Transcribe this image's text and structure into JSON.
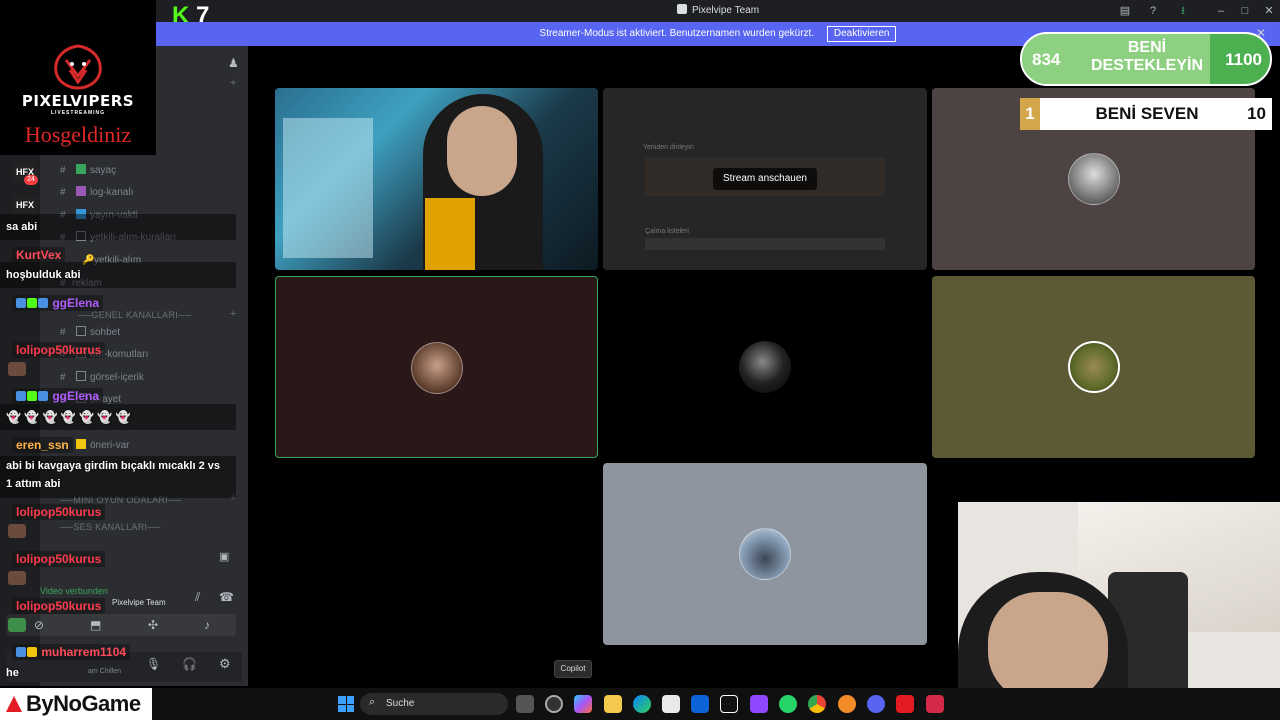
{
  "window": {
    "title": "Pixelvipe Team"
  },
  "banner": {
    "text": "Streamer-Modus ist aktiviert. Benutzernamen wurden gekürzt.",
    "button_label": "Deaktivieren"
  },
  "logo": {
    "brand": "PIXELVIPERS",
    "sub": "LIVESTREAMING",
    "welcome": "Hosgeldiniz"
  },
  "kick_counter": {
    "value": "7"
  },
  "sidebar": {
    "categories": [
      "GENEL KANALLARI",
      "MİNİ OYUN ODALARI",
      "SES KANALLARI"
    ],
    "channels": [
      "sayaç",
      "log-kanalı",
      "yayın-vakti",
      "yetkili-alım-kuralları",
      "yetkili-alım",
      "reklam",
      "sohbet",
      "bot-komutları",
      "görsel-içerik",
      "şikayet",
      "öneri-var"
    ],
    "voice_status": "Video verbunden",
    "voice_channel": "Pixelvipe Team",
    "user_status": "am Chillen"
  },
  "chat": [
    {
      "user": "",
      "message": "sa abi"
    },
    {
      "user": "KurtVex",
      "message": "hoşbulduk abi"
    },
    {
      "user": "ggElena",
      "message": ""
    },
    {
      "user": "lolipop50kurus",
      "message": ""
    },
    {
      "user": "ggElena",
      "message": "👻 👻 👻 👻 👻 👻 👻"
    },
    {
      "user": "eren_ssn",
      "message": "abi bi kavgaya girdim bıçaklı mıcaklı 2 vs 1 attım abi"
    },
    {
      "user": "lolipop50kurus",
      "message": ""
    },
    {
      "user": "lolipop50kurus",
      "message": ""
    },
    {
      "user": "lolipop50kurus",
      "message": ""
    },
    {
      "user": "muharrem1104",
      "message": "he"
    }
  ],
  "chat_colors": {
    "KurtVex": "#ff4b5c",
    "ggElena": "#b15cff",
    "lolipop50kurus": "#ff3b4e",
    "eren_ssn": "#ffb347",
    "muharrem1104": "#ff4b5c"
  },
  "video": {
    "stream_label": "Stream anschauen",
    "screen_overlay_heading": "Yeniden dinleyin",
    "screen_overlay_section": "Çalma listeleri"
  },
  "goal": {
    "current": "834",
    "label": "BENİ DESTEKLEYİN",
    "max": "1100",
    "progress": 0.758
  },
  "lover_widget": {
    "rank": "1",
    "label": "BENİ SEVEN",
    "value": "10"
  },
  "taskbar": {
    "search_label": "Suche",
    "tooltip": "Copilot",
    "sponsor": "ByNoGame"
  },
  "colors": {
    "accent": "#5865f2",
    "kick_green": "#53fc18",
    "goal_green": "#4caf50",
    "gold": "#d4a64a"
  }
}
